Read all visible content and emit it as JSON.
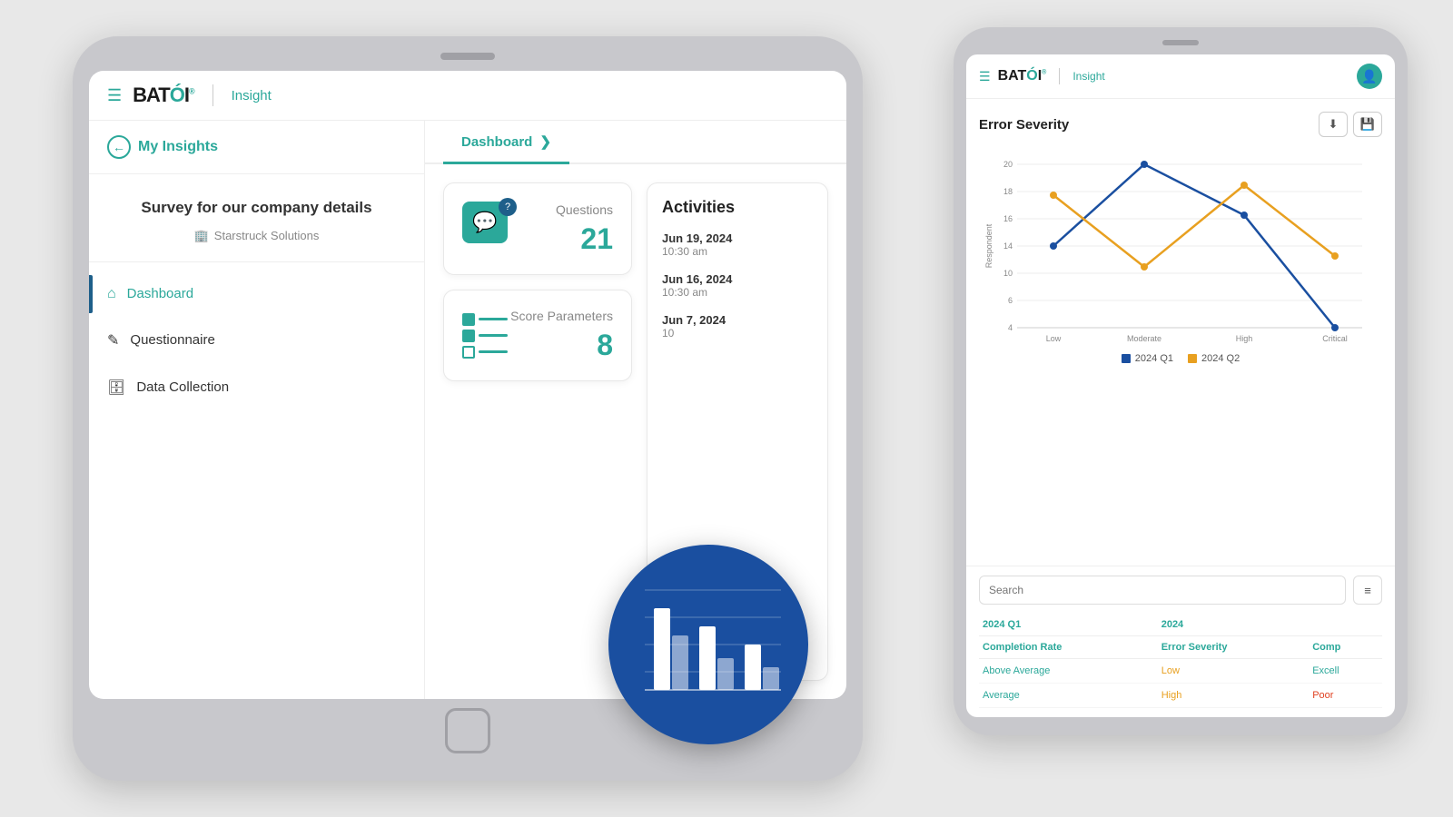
{
  "scene": {
    "background": "#e8e8e8"
  },
  "tablet_large": {
    "header": {
      "menu_icon": "☰",
      "logo": "BATÓI",
      "insight_label": "Insight"
    },
    "sidebar": {
      "my_insights_label": "My Insights",
      "survey_title": "Survey for our company details",
      "company_name": "Starstruck Solutions",
      "nav_items": [
        {
          "id": "dashboard",
          "label": "Dashboard",
          "icon": "⌂",
          "active": true
        },
        {
          "id": "questionnaire",
          "label": "Questionnaire",
          "icon": "✏",
          "active": false
        },
        {
          "id": "data-collection",
          "label": "Data Collection",
          "icon": "🗄",
          "active": false
        }
      ]
    },
    "tabs": [
      {
        "id": "dashboard",
        "label": "Dashboard",
        "active": true
      }
    ],
    "stats": [
      {
        "id": "questions",
        "label": "Questions",
        "value": "21"
      },
      {
        "id": "score-parameters",
        "label": "Score Parameters",
        "value": "8"
      }
    ],
    "activities": {
      "title": "Activities",
      "items": [
        {
          "date": "Jun 19, 2024",
          "time": "10:30 am"
        },
        {
          "date": "Jun 16, 2024",
          "time": "10:30 am"
        },
        {
          "date": "Jun 7, 2024",
          "time": "10"
        }
      ]
    }
  },
  "tablet_small": {
    "header": {
      "menu_icon": "☰",
      "logo": "BATÓI",
      "insight_label": "Insight",
      "avatar_icon": "👤"
    },
    "chart": {
      "title": "Error Severity",
      "download_icon": "⬇",
      "save_icon": "💾",
      "x_labels": [
        "Low",
        "Moderate",
        "High",
        "Critical"
      ],
      "y_max": 20,
      "legend": [
        {
          "id": "q1",
          "label": "2024 Q1",
          "color": "#1a4fa0"
        },
        {
          "id": "q2",
          "label": "2024 Q2",
          "color": "#e8a020"
        }
      ],
      "q1_points": [
        12,
        20,
        15,
        4
      ],
      "q2_points": [
        17,
        10,
        18,
        11
      ]
    },
    "search": {
      "placeholder": "Search"
    },
    "table": {
      "headers": [
        "2024 Q1",
        "2024",
        ""
      ],
      "sub_headers": [
        "Completion Rate",
        "Error Severity",
        "Comp"
      ],
      "rows": [
        {
          "completion_rate": "Above Average",
          "error_severity": "Low",
          "comp": "Excell"
        },
        {
          "completion_rate": "Average",
          "error_severity": "High",
          "comp": "Poor"
        }
      ]
    }
  },
  "circle_badge": {
    "chart_type": "bar",
    "colors": [
      "#4a90d9",
      "#fff",
      "#7ab3e0"
    ]
  }
}
